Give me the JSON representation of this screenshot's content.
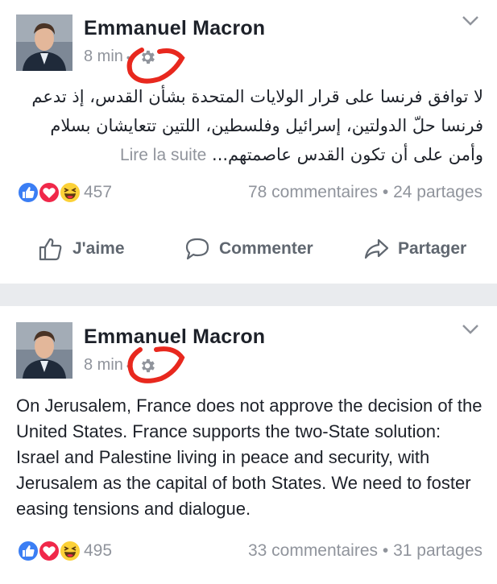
{
  "posts": [
    {
      "author": "Emmanuel Macron",
      "time": "8 min",
      "text_ar": "لا توافق فرنسا على قرار الولايات المتحدة بشأن القدس، إذ تدعم فرنسا حلّ الدولتين، إسرائيل وفلسطين، اللتين تتعايشان بسلام وأمن على أن تكون القدس عاصمتهم...",
      "see_more": "Lire la suite",
      "reactions_count": "457",
      "comments": "78 commentaires",
      "shares": "24 partages",
      "actions": {
        "like": "J'aime",
        "comment": "Commenter",
        "share": "Partager"
      }
    },
    {
      "author": "Emmanuel Macron",
      "time": "8 min",
      "text_en": "On Jerusalem, France does not approve the decision of the United States. France supports the two-State solution: Israel and Palestine living in peace and security, with Jerusalem as the capital of both States. We need to foster easing tensions and dialogue.",
      "reactions_count": "495",
      "comments": "33 commentaires",
      "shares": "31 partages"
    }
  ],
  "separator_dot": "•",
  "icons": {
    "audience": "gear-icon",
    "menu": "chevron-down-icon",
    "reactions": [
      "like-reaction-icon",
      "love-reaction-icon",
      "haha-reaction-icon"
    ]
  },
  "colors": {
    "author": "#1d2129",
    "meta": "#90949c",
    "annotation": "#e8281e",
    "like_blue": "#3b7ef4",
    "love_red": "#f0284a",
    "haha_yellow": "#fcd138",
    "separator": "#e9ebee"
  }
}
